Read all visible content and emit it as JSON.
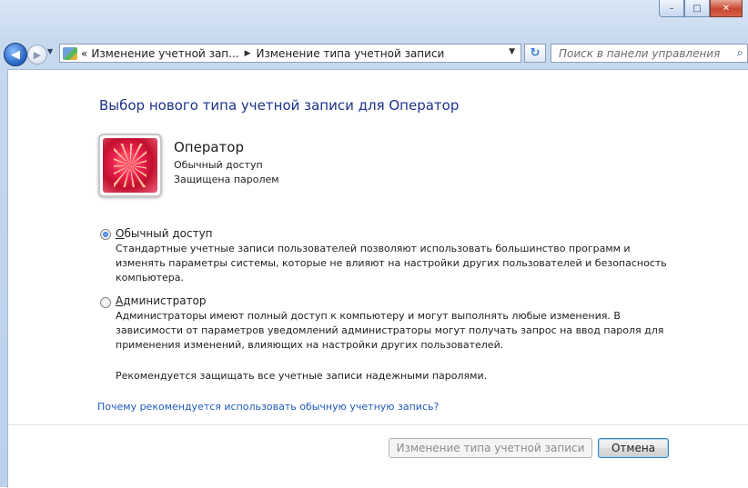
{
  "window": {
    "minimize_label": "–",
    "maximize_label": "□",
    "close_label": "✕"
  },
  "nav": {
    "back_glyph": "◀",
    "forward_glyph": "▶",
    "history_glyph": "▼"
  },
  "addressbar": {
    "prefix": "«",
    "crumb1": "Изменение учетной зап...",
    "separator": "▶",
    "crumb2": "Изменение типа учетной записи",
    "dropdown_glyph": "▼"
  },
  "refresh_glyph": "↻",
  "search": {
    "placeholder": "Поиск в панели управления",
    "icon_glyph": "⌕"
  },
  "main": {
    "title": "Выбор нового типа учетной записи для Оператор",
    "user": {
      "name": "Оператор",
      "type": "Обычный доступ",
      "password_status": "Защищена паролем"
    },
    "options": [
      {
        "label_accel": "О",
        "label_rest": "бычный доступ",
        "checked": true,
        "description": "Стандартные учетные записи пользователей позволяют использовать большинство программ и изменять параметры системы, которые не влияют на настройки других пользователей и безопасность компьютера."
      },
      {
        "label_accel": "А",
        "label_rest": "дминистратор",
        "checked": false,
        "description": "Администраторы имеют полный доступ к компьютеру и могут выполнять любые изменения. В зависимости от параметров уведомлений администраторы могут получать запрос на ввод пароля для применения изменений, влияющих на настройки других пользователей."
      }
    ],
    "recommendation": "Рекомендуется защищать все учетные записи надежными паролями.",
    "help_link": "Почему рекомендуется использовать обычную учетную запись?"
  },
  "buttons": {
    "change_type": "Изменение типа учетной записи",
    "cancel": "Отмена"
  },
  "colors": {
    "title": "#1e3287",
    "link": "#1f5ab5",
    "frame": "#c6d8ee"
  }
}
